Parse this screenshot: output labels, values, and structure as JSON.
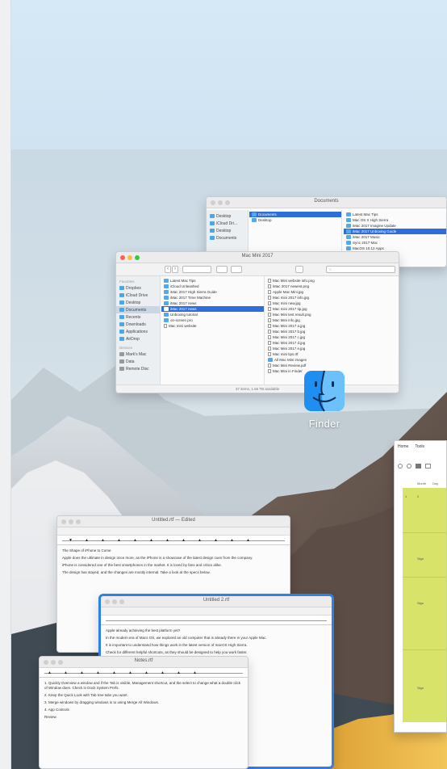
{
  "desktop": {
    "finder_label": "Finder",
    "accent": "#2f6ed8"
  },
  "finder_back": {
    "title": "Documents",
    "sidebar": [
      "Desktop",
      "iCloud Dri...",
      "Desktop",
      "Documents"
    ],
    "col1": [
      "Documents",
      "Desktop"
    ],
    "col2": [
      "Latest Mac Tips",
      "Mac OS X High Sierra",
      "iMac 2017 Imagine Update",
      "iMac 2017 Unboxing Guide",
      "iMac 2017 Music",
      "Sync 2017 Mac",
      "MacOS 10.12 Apps"
    ]
  },
  "finder_front": {
    "title": "Mac Mini 2017",
    "status": "37 items, 1.66 TB available",
    "sidebar_head": "Favorites",
    "sidebar": [
      {
        "label": "Dropbox",
        "sel": false
      },
      {
        "label": "iCloud Drive",
        "sel": false
      },
      {
        "label": "Desktop",
        "sel": false
      },
      {
        "label": "Documents",
        "sel": true
      },
      {
        "label": "Recents",
        "sel": false
      },
      {
        "label": "Downloads",
        "sel": false
      },
      {
        "label": "Applications",
        "sel": false
      },
      {
        "label": "AirDrop",
        "sel": false
      }
    ],
    "devices_head": "Devices",
    "devices": [
      "Mark's Mac",
      "Data",
      "Remote Disc"
    ],
    "col1": [
      {
        "label": "Latest Mac Tips",
        "sel": false
      },
      {
        "label": "iCloud Unleashed",
        "sel": false
      },
      {
        "label": "iMac 2017 High Sierra Guide",
        "sel": false
      },
      {
        "label": "iMac 2017 Time Machine",
        "sel": false
      },
      {
        "label": "iMac 2017 news",
        "sel": false
      },
      {
        "label": "iMac 2017 news",
        "sel": true
      },
      {
        "label": "Unboxing tutorial",
        "sel": false
      },
      {
        "label": "on-screen pro",
        "sel": false
      },
      {
        "label": "Mac mini website",
        "sel": false
      }
    ],
    "col2": [
      "Mac Mini website info.png",
      "iMac 2017 newest.png",
      "Apple Mac Mini.jpg",
      "Mac mini 2017 info.jpg",
      "Mac mini new.jpg",
      "Mac mini 2017 tip.jpg",
      "Mac Mini test result.png",
      "Mac Mini info.jpg",
      "Mac Mini 2017 a.jpg",
      "Mac Mini 2017 b.jpg",
      "Mac Mini 2017 c.jpg",
      "Mac Mini 2017 d.jpg",
      "Mac Mini 2017 e.jpg",
      "Mac mini tips.rtf",
      "All Mac Mini images",
      "Mac Mini Review.pdf",
      "Mac Mini in Finder"
    ]
  },
  "text_windows": [
    {
      "title": "Untitled.rtf — Edited",
      "lines": [
        "The Shape of iPhone to Come",
        "Apple does the ultimate in design once more, as the iPhone is a showcase of the latest design cues from the company.",
        "iPhone is considered one of the best smartphones in the market. It is loved by fans and critics alike.",
        "The design has stayed, and the changes are mostly internal. Take a look at the specs below."
      ]
    },
    {
      "title": "Untitled 2.rtf",
      "lines": [
        "Apple already achieving the best platform yet?",
        "In the modern era of Macs OS, we explored an old computer that is already there in your Apple Mac.",
        "It is important to understand how things work in the latest version of macOS High Sierra.",
        "Check for different helpful shortcuts, as they should be designed to help you work faster."
      ]
    },
    {
      "title": "Notes.rtf",
      "lines": [
        "1. Quickly Overview a window and if the Tab is visible, Management shortcut, and the select to change what a double click of Window does. Check in Dock System Prefs.",
        "2. Keep the Quick Look with Tab tree tabs you want.",
        "3. Merge windows by dragging windows in to using Merge All Windows.",
        "4. App Controls",
        "Review"
      ]
    }
  ],
  "spreadsheet": {
    "tabs": [
      "Home",
      "Tools"
    ],
    "header_cells": [
      "Month",
      "Day"
    ],
    "cells": [
      "1",
      "2",
      "Sign",
      "Sign",
      "Sign"
    ]
  }
}
